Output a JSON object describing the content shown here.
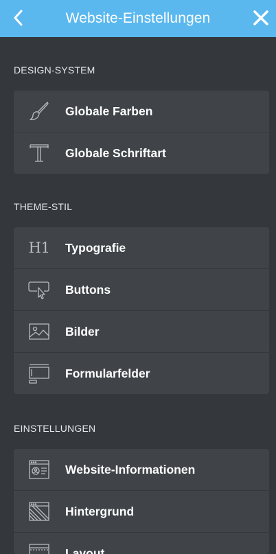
{
  "header": {
    "title": "Website-Einstellungen",
    "back_icon": "chevron-left-icon",
    "close_icon": "close-icon"
  },
  "colors": {
    "header_bg": "#5ab8ee",
    "page_bg": "#34383c",
    "card_bg": "#404449",
    "icon": "#b9bdc2"
  },
  "sections": [
    {
      "label": "DESIGN-SYSTEM",
      "items": [
        {
          "label": "Globale Farben",
          "icon": "paintbrush-icon"
        },
        {
          "label": "Globale Schriftart",
          "icon": "font-t-icon"
        }
      ]
    },
    {
      "label": "THEME-STIL",
      "items": [
        {
          "label": "Typografie",
          "icon": "heading-h1-icon",
          "icon_text": "H1"
        },
        {
          "label": "Buttons",
          "icon": "button-cursor-icon"
        },
        {
          "label": "Bilder",
          "icon": "image-icon"
        },
        {
          "label": "Formularfelder",
          "icon": "form-field-icon"
        }
      ]
    },
    {
      "label": "EINSTELLUNGEN",
      "items": [
        {
          "label": "Website-Informationen",
          "icon": "site-info-icon"
        },
        {
          "label": "Hintergrund",
          "icon": "background-icon"
        },
        {
          "label": "Layout",
          "icon": "layout-icon"
        }
      ]
    }
  ]
}
